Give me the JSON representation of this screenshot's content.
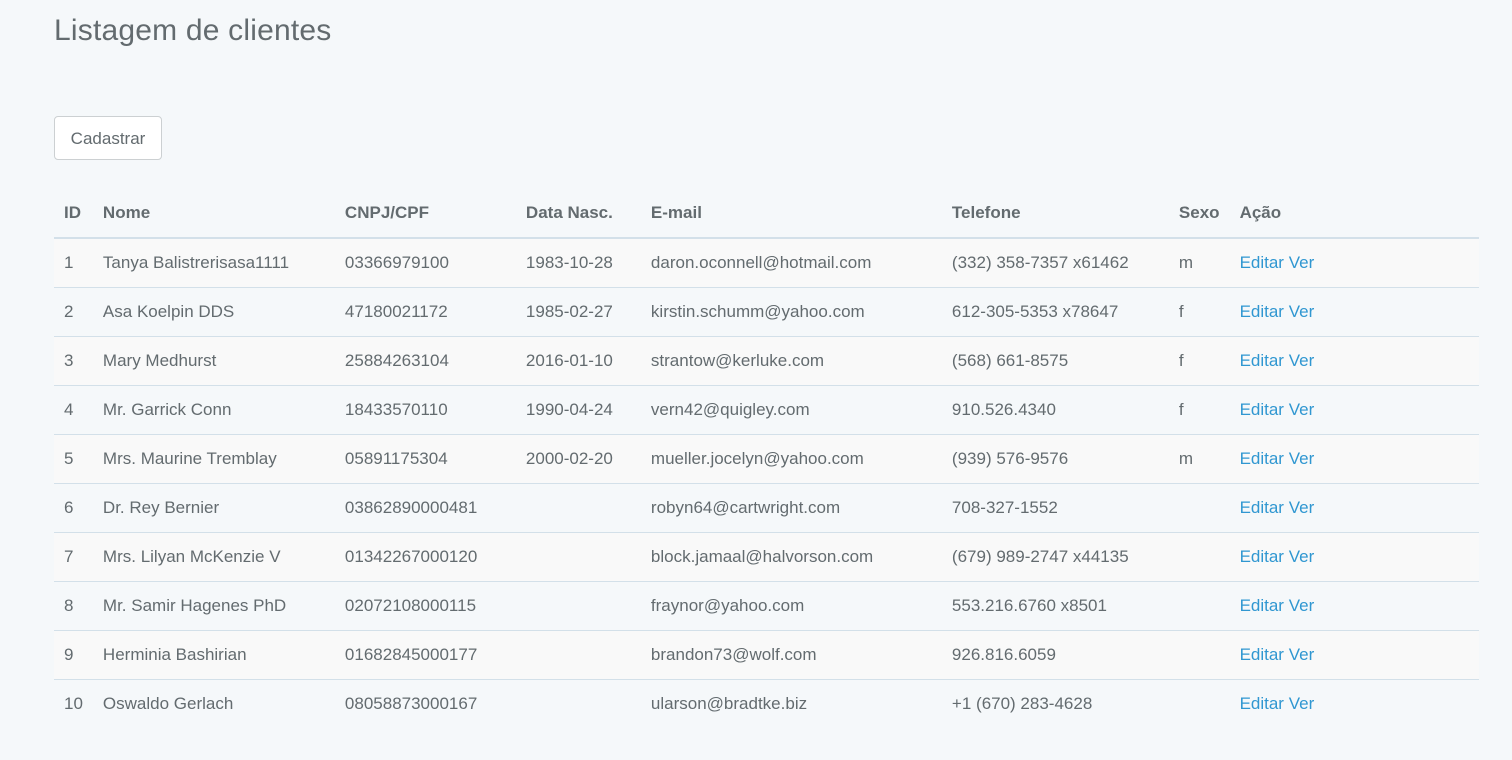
{
  "page": {
    "title": "Listagem de clientes",
    "register_button": "Cadastrar"
  },
  "table": {
    "headers": {
      "id": "ID",
      "nome": "Nome",
      "doc": "CNPJ/CPF",
      "nasc": "Data Nasc.",
      "email": "E-mail",
      "telefone": "Telefone",
      "sexo": "Sexo",
      "acao": "Ação"
    },
    "action_labels": {
      "edit": "Editar",
      "view": "Ver"
    },
    "rows": [
      {
        "id": "1",
        "nome": "Tanya Balistrerisasa1111",
        "doc": "03366979100",
        "nasc": "1983-10-28",
        "email": "daron.oconnell@hotmail.com",
        "telefone": "(332) 358-7357 x61462",
        "sexo": "m",
        "edit": "Editar",
        "view": "Ver"
      },
      {
        "id": "2",
        "nome": "Asa Koelpin DDS",
        "doc": "47180021172",
        "nasc": "1985-02-27",
        "email": "kirstin.schumm@yahoo.com",
        "telefone": "612-305-5353 x78647",
        "sexo": "f",
        "edit": "Editar",
        "view": "Ver"
      },
      {
        "id": "3",
        "nome": "Mary Medhurst",
        "doc": "25884263104",
        "nasc": "2016-01-10",
        "email": "strantow@kerluke.com",
        "telefone": "(568) 661-8575",
        "sexo": "f",
        "edit": "Editar",
        "view": "Ver"
      },
      {
        "id": "4",
        "nome": "Mr. Garrick Conn",
        "doc": "18433570110",
        "nasc": "1990-04-24",
        "email": "vern42@quigley.com",
        "telefone": "910.526.4340",
        "sexo": "f",
        "edit": "Editar",
        "view": "Ver"
      },
      {
        "id": "5",
        "nome": "Mrs. Maurine Tremblay",
        "doc": "05891175304",
        "nasc": "2000-02-20",
        "email": "mueller.jocelyn@yahoo.com",
        "telefone": "(939) 576-9576",
        "sexo": "m",
        "edit": "Editar",
        "view": "Ver"
      },
      {
        "id": "6",
        "nome": "Dr. Rey Bernier",
        "doc": "03862890000481",
        "nasc": "",
        "email": "robyn64@cartwright.com",
        "telefone": "708-327-1552",
        "sexo": "",
        "edit": "Editar",
        "view": "Ver"
      },
      {
        "id": "7",
        "nome": "Mrs. Lilyan McKenzie V",
        "doc": "01342267000120",
        "nasc": "",
        "email": "block.jamaal@halvorson.com",
        "telefone": "(679) 989-2747 x44135",
        "sexo": "",
        "edit": "Editar",
        "view": "Ver"
      },
      {
        "id": "8",
        "nome": "Mr. Samir Hagenes PhD",
        "doc": "02072108000115",
        "nasc": "",
        "email": "fraynor@yahoo.com",
        "telefone": "553.216.6760 x8501",
        "sexo": "",
        "edit": "Editar",
        "view": "Ver"
      },
      {
        "id": "9",
        "nome": "Herminia Bashirian",
        "doc": "01682845000177",
        "nasc": "",
        "email": "brandon73@wolf.com",
        "telefone": "926.816.6059",
        "sexo": "",
        "edit": "Editar",
        "view": "Ver"
      },
      {
        "id": "10",
        "nome": "Oswaldo Gerlach",
        "doc": "08058873000167",
        "nasc": "",
        "email": "ularson@bradtke.biz",
        "telefone": "+1 (670) 283-4628",
        "sexo": "",
        "edit": "Editar",
        "view": "Ver"
      }
    ]
  }
}
